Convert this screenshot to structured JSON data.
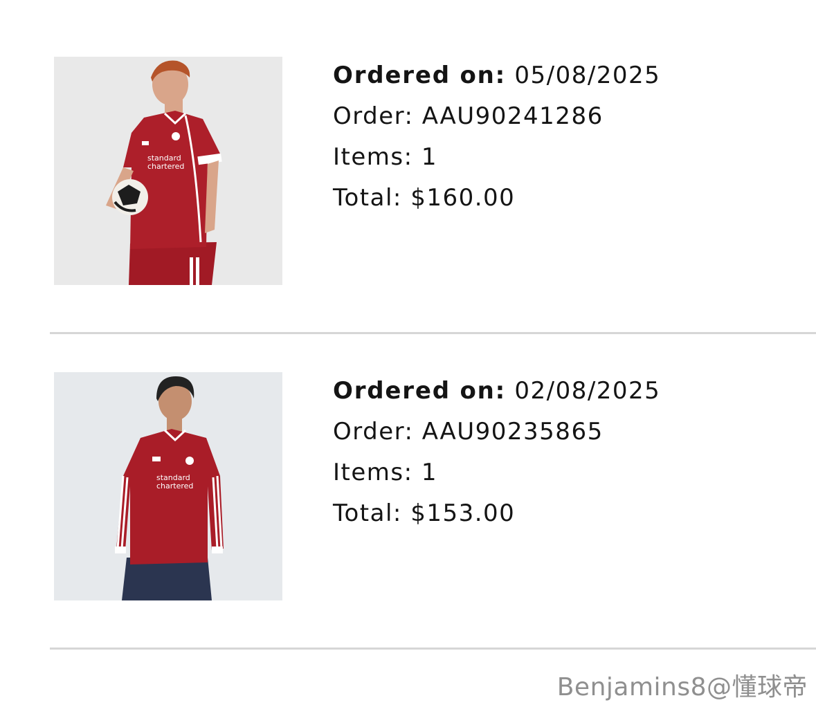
{
  "orders": [
    {
      "ordered_on_label": "Ordered on:",
      "ordered_on_value": "05/08/2025",
      "order_label": "Order:",
      "order_number": "AAU90241286",
      "items_label": "Items:",
      "items_count": "1",
      "total_label": "Total:",
      "total_value": "$160.00",
      "image": "liverpool-home-jersey-short-sleeve-with-ball",
      "image_bg": "#e8e8e8"
    },
    {
      "ordered_on_label": "Ordered on:",
      "ordered_on_value": "02/08/2025",
      "order_label": "Order:",
      "order_number": "AAU90235865",
      "items_label": "Items:",
      "items_count": "1",
      "total_label": "Total:",
      "total_value": "$153.00",
      "image": "liverpool-home-jersey-long-sleeve",
      "image_bg": "#e6e9ec"
    }
  ],
  "watermark": "Benjamins8@懂球帝",
  "colors": {
    "jersey_red": "#a91d28",
    "divider": "#d6d6d6",
    "text": "#141414",
    "watermark": "#8f8f8f"
  }
}
